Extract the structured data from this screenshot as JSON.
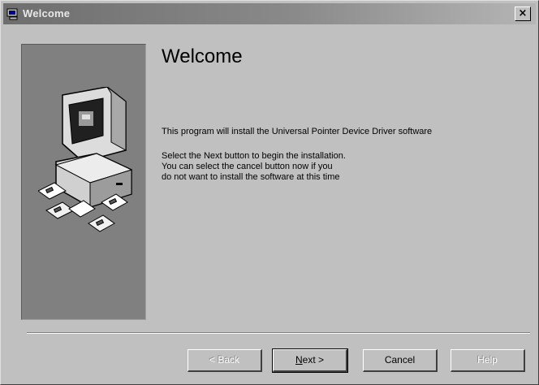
{
  "window": {
    "title": "Welcome",
    "close_glyph": "×"
  },
  "icons": {
    "title": "setup-window-icon",
    "close": "close-icon",
    "illustration": "computer-with-disks-illustration"
  },
  "content": {
    "heading": "Welcome",
    "lines": [
      "This program will install the Universal Pointer Device Driver software",
      "Select the Next button to begin the installation.",
      "You can select the cancel button now if you",
      "do not want to install the software at this time"
    ]
  },
  "buttons": {
    "back": "< Back",
    "next_accel": "N",
    "next_rest": "ext >",
    "cancel": "Cancel",
    "help": "Help"
  },
  "colors": {
    "face": "#c0c0c0",
    "side_panel": "#808080",
    "titlebar": "#7a7a7a"
  }
}
